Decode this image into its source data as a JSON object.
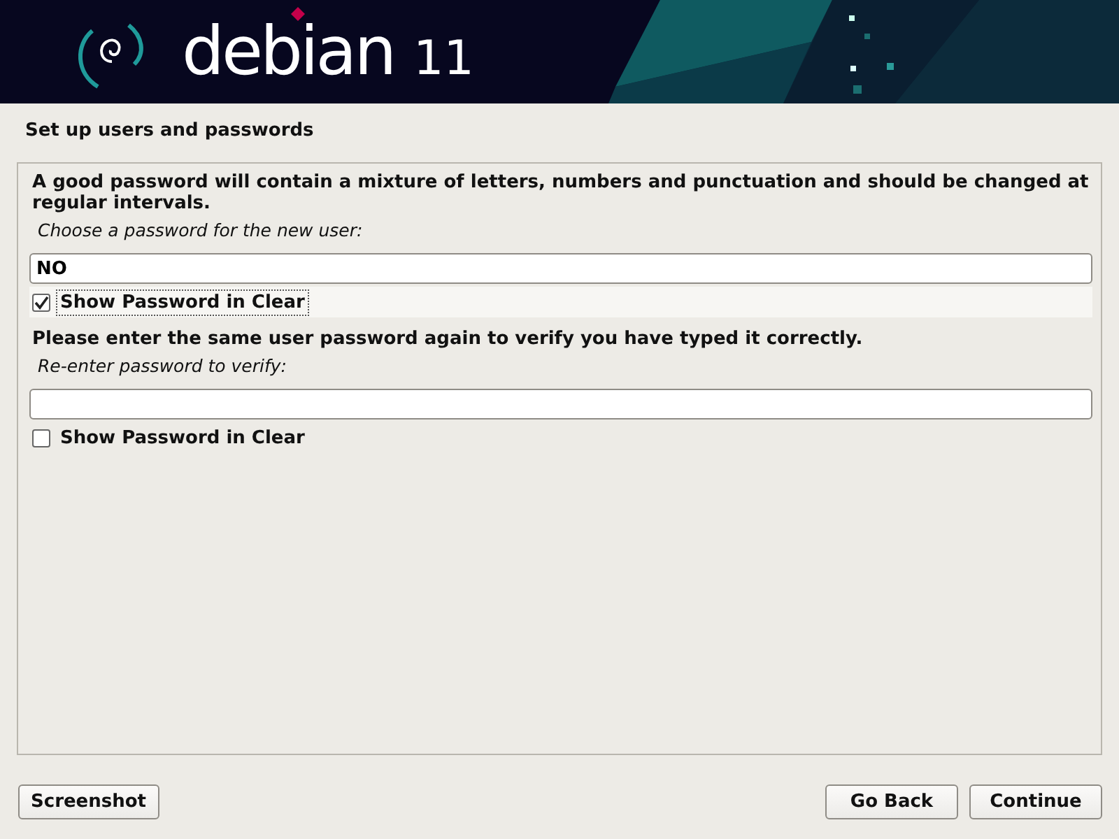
{
  "header": {
    "logo_text": "debian",
    "version": "11"
  },
  "page_title": "Set up users and passwords",
  "sections": [
    {
      "prompt": "A good password will contain a mixture of letters, numbers and punctuation and should be changed at regular intervals.",
      "label": "Choose a password for the new user:",
      "value": "NO",
      "show_clear": {
        "label": "Show Password in Clear",
        "checked": true,
        "focused": true
      }
    },
    {
      "prompt": "Please enter the same user password again to verify you have typed it correctly.",
      "label": "Re-enter password to verify:",
      "show_clear": {
        "label": "Show Password in Clear",
        "checked": false,
        "focused": false
      }
    }
  ],
  "buttons": [
    {
      "label": "Screenshot",
      "kind": "aux"
    },
    {
      "label": "Go Back",
      "kind": "nav"
    },
    {
      "label": "Continue",
      "kind": "nav"
    }
  ]
}
